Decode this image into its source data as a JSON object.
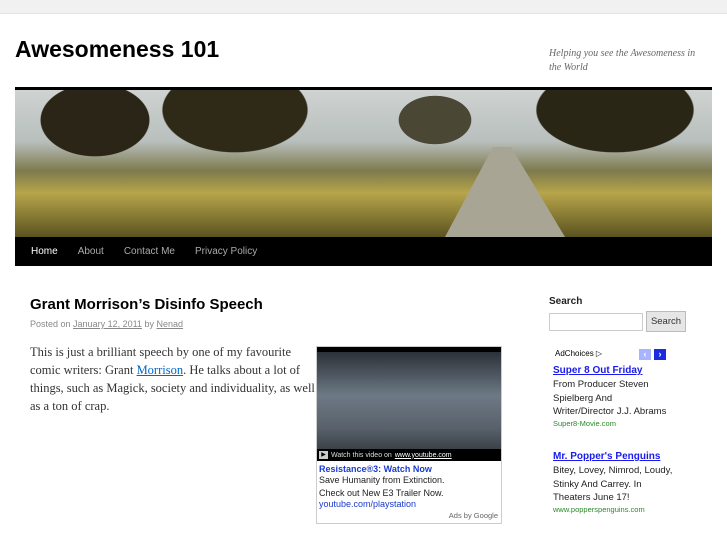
{
  "site": {
    "title": "Awesomeness 101",
    "tagline": "Helping you see the Awesomeness in the World"
  },
  "nav": [
    {
      "label": "Home"
    },
    {
      "label": "About"
    },
    {
      "label": "Contact Me"
    },
    {
      "label": "Privacy Policy"
    }
  ],
  "post": {
    "title": "Grant Morrison’s Disinfo Speech",
    "posted_on": "Posted on",
    "date": "January 12, 2011",
    "by": "by",
    "author": "Nenad",
    "body_before": "This is just a brilliant speech by one of my favourite comic writers: Grant ",
    "body_link": "Morrison",
    "body_after": ". He talks about a lot of things, such as Magick, society and individuality, as well as a ton of crap."
  },
  "video_ad": {
    "play": "▶",
    "watch_text": "Watch this video on",
    "watch_link": "www.youtube.com",
    "title": "Resistance®3: Watch Now",
    "line1": "Save Humanity from Extinction.",
    "line2": "Check out New E3 Trailer Now.",
    "url": "youtube.com/playstation",
    "ads_by": "Ads by Google"
  },
  "sidebar": {
    "search_heading": "Search",
    "search_value": "",
    "search_button": "Search",
    "adchoices": "AdChoices ▷",
    "prev": "‹",
    "next": "›",
    "ads": [
      {
        "title": "Super 8 Out Friday",
        "desc": "From Producer Steven Spielberg And Writer/Director J.J. Abrams",
        "url": "Super8-Movie.com"
      },
      {
        "title": "Mr. Popper's Penguins",
        "desc": "Bitey, Lovey, Nimrod, Loudy, Stinky And Carrey. In Theaters June 17!",
        "url": "www.popperspenguins.com"
      }
    ]
  }
}
